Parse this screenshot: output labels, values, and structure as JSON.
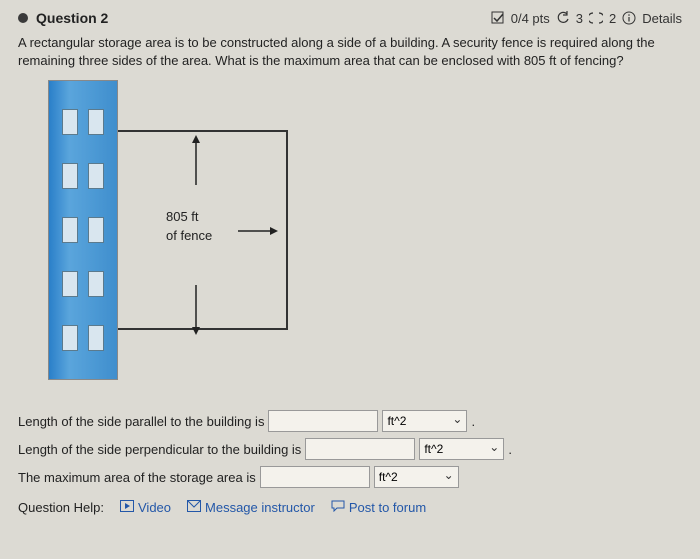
{
  "question": {
    "title": "Question 2",
    "points": "0/4 pts",
    "retries": "3",
    "attempts": "2",
    "details": "Details",
    "prompt": "A rectangular storage area is to be constructed along a side of a building. A security fence is required along the remaining three sides of the area. What is the maximum area that can be enclosed with 805 ft of fencing?"
  },
  "figure": {
    "fence_label_line1": "805 ft",
    "fence_label_line2": "of fence"
  },
  "answers": {
    "row1": {
      "label": "Length of the side parallel to the building is",
      "unit": "ft^2"
    },
    "row2": {
      "label": "Length of the side perpendicular to the building is",
      "unit": "ft^2"
    },
    "row3": {
      "label": "The maximum area of the storage area is",
      "unit": "ft^2"
    }
  },
  "help": {
    "label": "Question Help:",
    "video": "Video",
    "message": "Message instructor",
    "forum": "Post to forum"
  }
}
